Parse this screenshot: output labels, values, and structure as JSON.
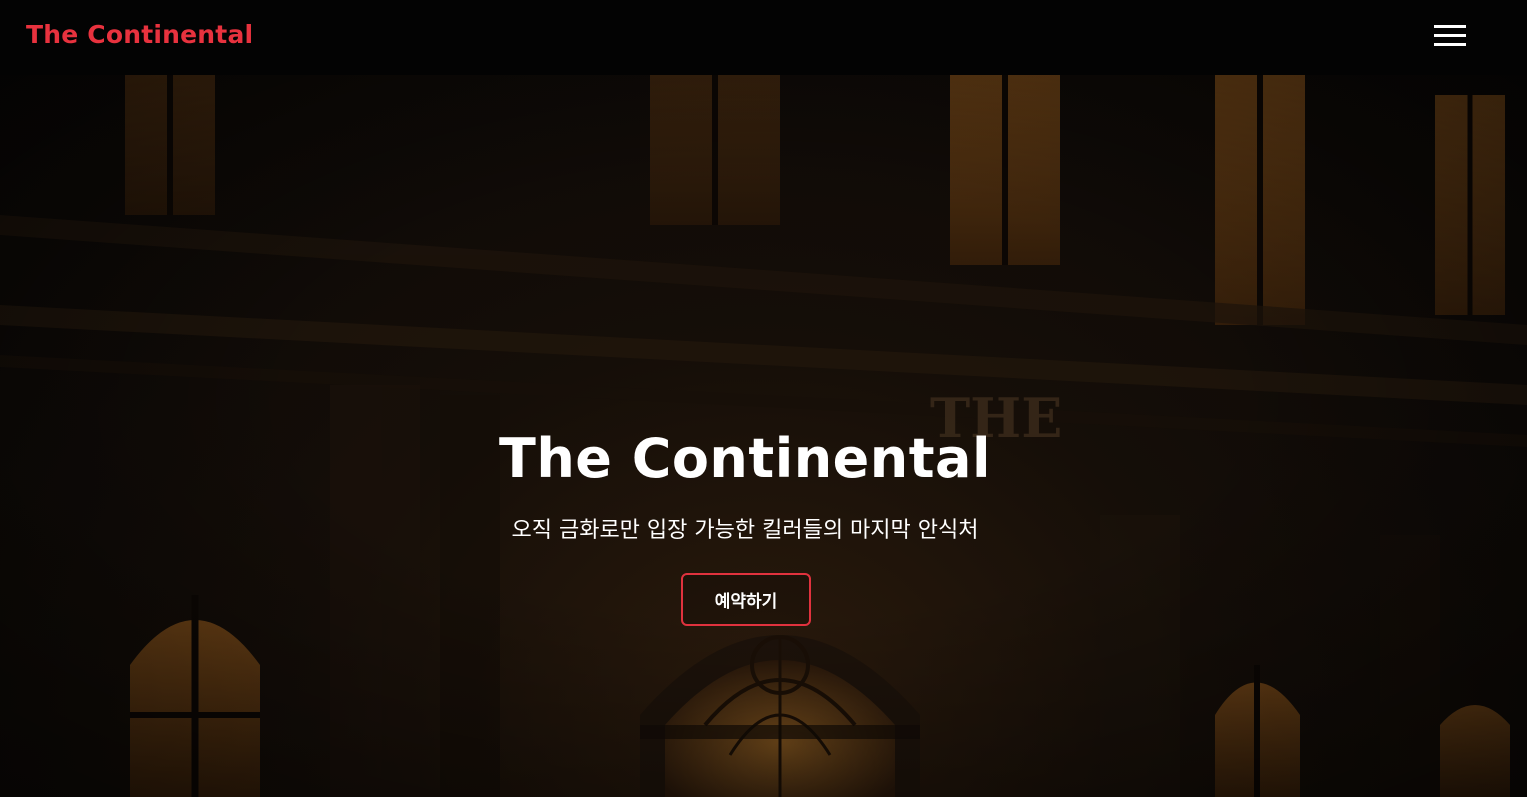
{
  "header": {
    "brand": "The Continental",
    "menu_icon": "hamburger-menu-icon"
  },
  "hero": {
    "background_text": "THE",
    "title": "The Continental",
    "subtitle": "오직 금화로만 입장 가능한 킬러들의 마지막 안식처",
    "cta_label": "예약하기"
  },
  "colors": {
    "accent": "#e8323e",
    "nav_background": "#030303",
    "text": "#ffffff"
  }
}
